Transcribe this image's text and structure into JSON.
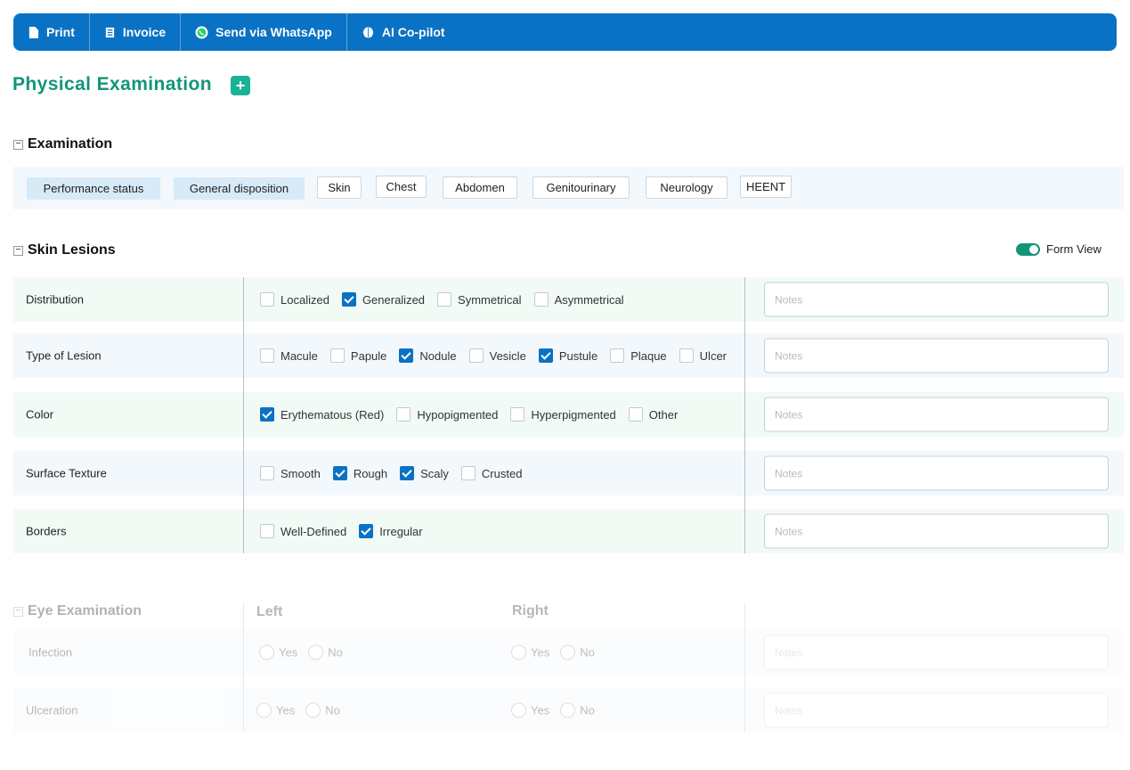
{
  "toolbar": {
    "print": "Print",
    "invoice": "Invoice",
    "whatsapp": "Send via WhatsApp",
    "copilot": "AI Co-pilot"
  },
  "page": {
    "title": "Physical Examination",
    "add_symbol": "+"
  },
  "examination": {
    "title": "Examination",
    "tabs": [
      {
        "label": "Performance status",
        "active": true
      },
      {
        "label": "General disposition",
        "active": true
      },
      {
        "label": "Skin",
        "active": false
      },
      {
        "label": "Chest",
        "active": false
      },
      {
        "label": "Abdomen",
        "active": false
      },
      {
        "label": "Genitourinary",
        "active": false
      },
      {
        "label": "Neurology",
        "active": false
      },
      {
        "label": "HEENT",
        "active": false
      }
    ]
  },
  "skin_lesions": {
    "title": "Skin Lesions",
    "form_view_label": "Form View",
    "form_view_on": true,
    "notes_placeholder": "Notes",
    "rows": [
      {
        "label": "Distribution",
        "options": [
          {
            "label": "Localized",
            "checked": false
          },
          {
            "label": "Generalized",
            "checked": true
          },
          {
            "label": "Symmetrical",
            "checked": false
          },
          {
            "label": "Asymmetrical",
            "checked": false
          }
        ]
      },
      {
        "label": "Type of Lesion",
        "options": [
          {
            "label": "Macule",
            "checked": false
          },
          {
            "label": "Papule",
            "checked": false
          },
          {
            "label": "Nodule",
            "checked": true
          },
          {
            "label": "Vesicle",
            "checked": false
          },
          {
            "label": "Pustule",
            "checked": true
          },
          {
            "label": "Plaque",
            "checked": false
          },
          {
            "label": "Ulcer",
            "checked": false
          }
        ]
      },
      {
        "label": "Color",
        "options": [
          {
            "label": "Erythematous (Red)",
            "checked": true
          },
          {
            "label": "Hypopigmented",
            "checked": false
          },
          {
            "label": "Hyperpigmented",
            "checked": false
          },
          {
            "label": "Other",
            "checked": false
          }
        ]
      },
      {
        "label": "Surface Texture",
        "options": [
          {
            "label": "Smooth",
            "checked": false
          },
          {
            "label": "Rough",
            "checked": true
          },
          {
            "label": "Scaly",
            "checked": true
          },
          {
            "label": "Crusted",
            "checked": false
          }
        ]
      },
      {
        "label": "Borders",
        "options": [
          {
            "label": "Well-Defined",
            "checked": false
          },
          {
            "label": "Irregular",
            "checked": true
          }
        ]
      }
    ]
  },
  "eye_exam": {
    "title": "Eye Examination",
    "left_label": "Left",
    "right_label": "Right",
    "yes": "Yes",
    "no": "No",
    "notes_placeholder": "Notes",
    "rows": [
      {
        "label": "Infection"
      },
      {
        "label": "Ulceration"
      }
    ]
  }
}
